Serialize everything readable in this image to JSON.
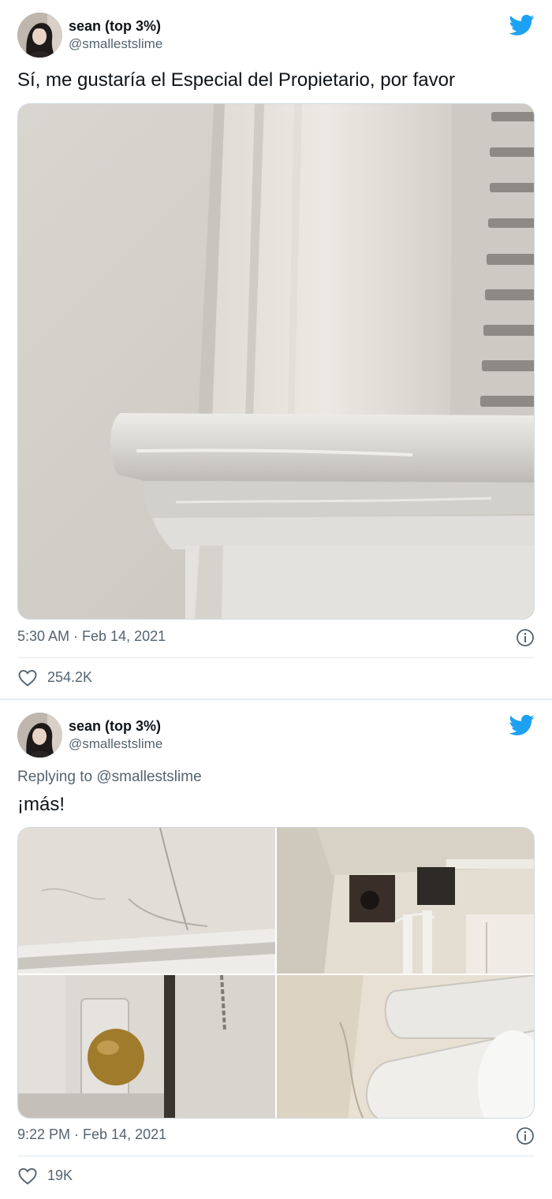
{
  "tweets": [
    {
      "author_name": "sean (top 3%)",
      "author_handle": "@smallestslime",
      "text": "Sí, me gustaría el Especial del Propietario, por favor",
      "timestamp": "5:30 AM · Feb 14, 2021",
      "likes": "254.2K"
    },
    {
      "author_name": "sean (top 3%)",
      "author_handle": "@smallestslime",
      "reply_to": "Replying to @smallestslime",
      "text": "¡más!",
      "timestamp": "9:22 PM · Feb 14, 2021",
      "likes": "19K"
    }
  ],
  "icons": {
    "brand": "twitter-bird-icon",
    "info": "info-icon",
    "like": "heart-icon"
  },
  "colors": {
    "twitter_blue": "#1da1f2",
    "secondary_text": "#536471",
    "primary_text": "#0f1419"
  }
}
